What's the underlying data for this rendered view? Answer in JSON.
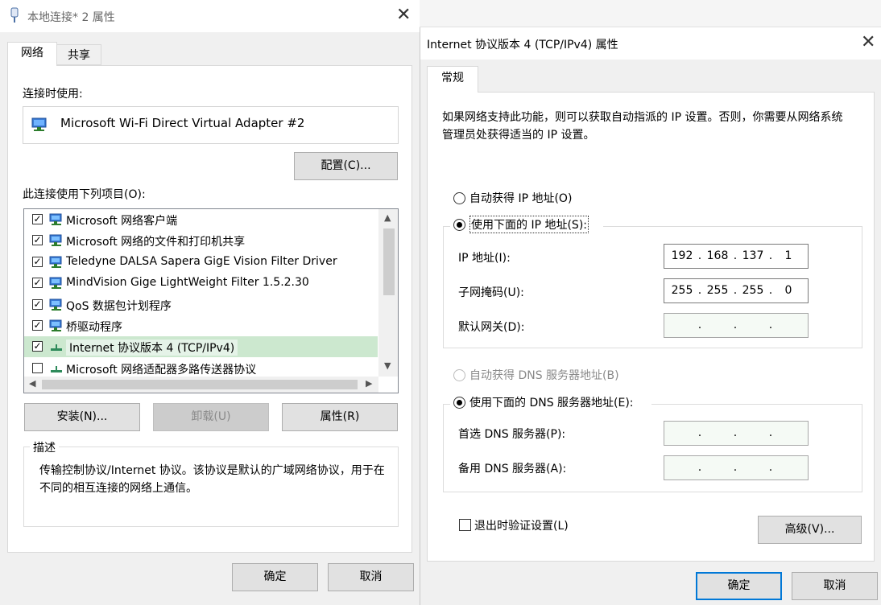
{
  "left_window": {
    "title": "本地连接* 2 属性",
    "tabs": [
      "网络",
      "共享"
    ],
    "connect_using_label": "连接时使用:",
    "adapter_name": "Microsoft Wi-Fi Direct Virtual Adapter #2",
    "configure_button": "配置(C)...",
    "items_label": "此连接使用下列项目(O):",
    "items": [
      {
        "label": "Microsoft 网络客户端",
        "checked": true,
        "icon": "network-client-icon"
      },
      {
        "label": "Microsoft 网络的文件和打印机共享",
        "checked": true,
        "icon": "network-service-icon"
      },
      {
        "label": "Teledyne DALSA Sapera GigE Vision Filter Driver",
        "checked": true,
        "icon": "network-service-icon"
      },
      {
        "label": "MindVision Gige LightWeight Filter 1.5.2.30",
        "checked": true,
        "icon": "network-service-icon"
      },
      {
        "label": "QoS 数据包计划程序",
        "checked": true,
        "icon": "network-service-icon"
      },
      {
        "label": "桥驱动程序",
        "checked": true,
        "icon": "network-service-icon"
      },
      {
        "label": "Internet 协议版本 4 (TCP/IPv4)",
        "checked": true,
        "icon": "protocol-icon",
        "selected": true
      },
      {
        "label": "Microsoft 网络适配器多路传送器协议",
        "checked": false,
        "icon": "protocol-icon"
      }
    ],
    "install_button": "安装(N)...",
    "uninstall_button": "卸载(U)",
    "properties_button": "属性(R)",
    "description_label": "描述",
    "description_text": "传输控制协议/Internet 协议。该协议是默认的广域网络协议，用于在不同的相互连接的网络上通信。",
    "ok_button": "确定",
    "cancel_button": "取消"
  },
  "right_window": {
    "title": "Internet 协议版本 4 (TCP/IPv4) 属性",
    "tab": "常规",
    "intro_text": "如果网络支持此功能，则可以获取自动指派的 IP 设置。否则，你需要从网络系统管理员处获得适当的 IP 设置。",
    "auto_ip_label": "自动获得 IP 地址(O)",
    "manual_ip_label": "使用下面的 IP 地址(S):",
    "ip_label": "IP 地址(I):",
    "ip_value": [
      "192",
      "168",
      "137",
      "1"
    ],
    "mask_label": "子网掩码(U):",
    "mask_value": [
      "255",
      "255",
      "255",
      "0"
    ],
    "gateway_label": "默认网关(D):",
    "gateway_value": [
      "",
      "",
      "",
      ""
    ],
    "auto_dns_label": "自动获得 DNS 服务器地址(B)",
    "manual_dns_label": "使用下面的 DNS 服务器地址(E):",
    "pref_dns_label": "首选 DNS 服务器(P):",
    "alt_dns_label": "备用 DNS 服务器(A):",
    "validate_label": "退出时验证设置(L)",
    "validate_checked": false,
    "advanced_button": "高级(V)...",
    "ok_button": "确定",
    "cancel_button": "取消"
  },
  "colors": {
    "selection": "#cce8cf",
    "default_button_border": "#0078d7",
    "window_bg": "#f0f0f0"
  }
}
